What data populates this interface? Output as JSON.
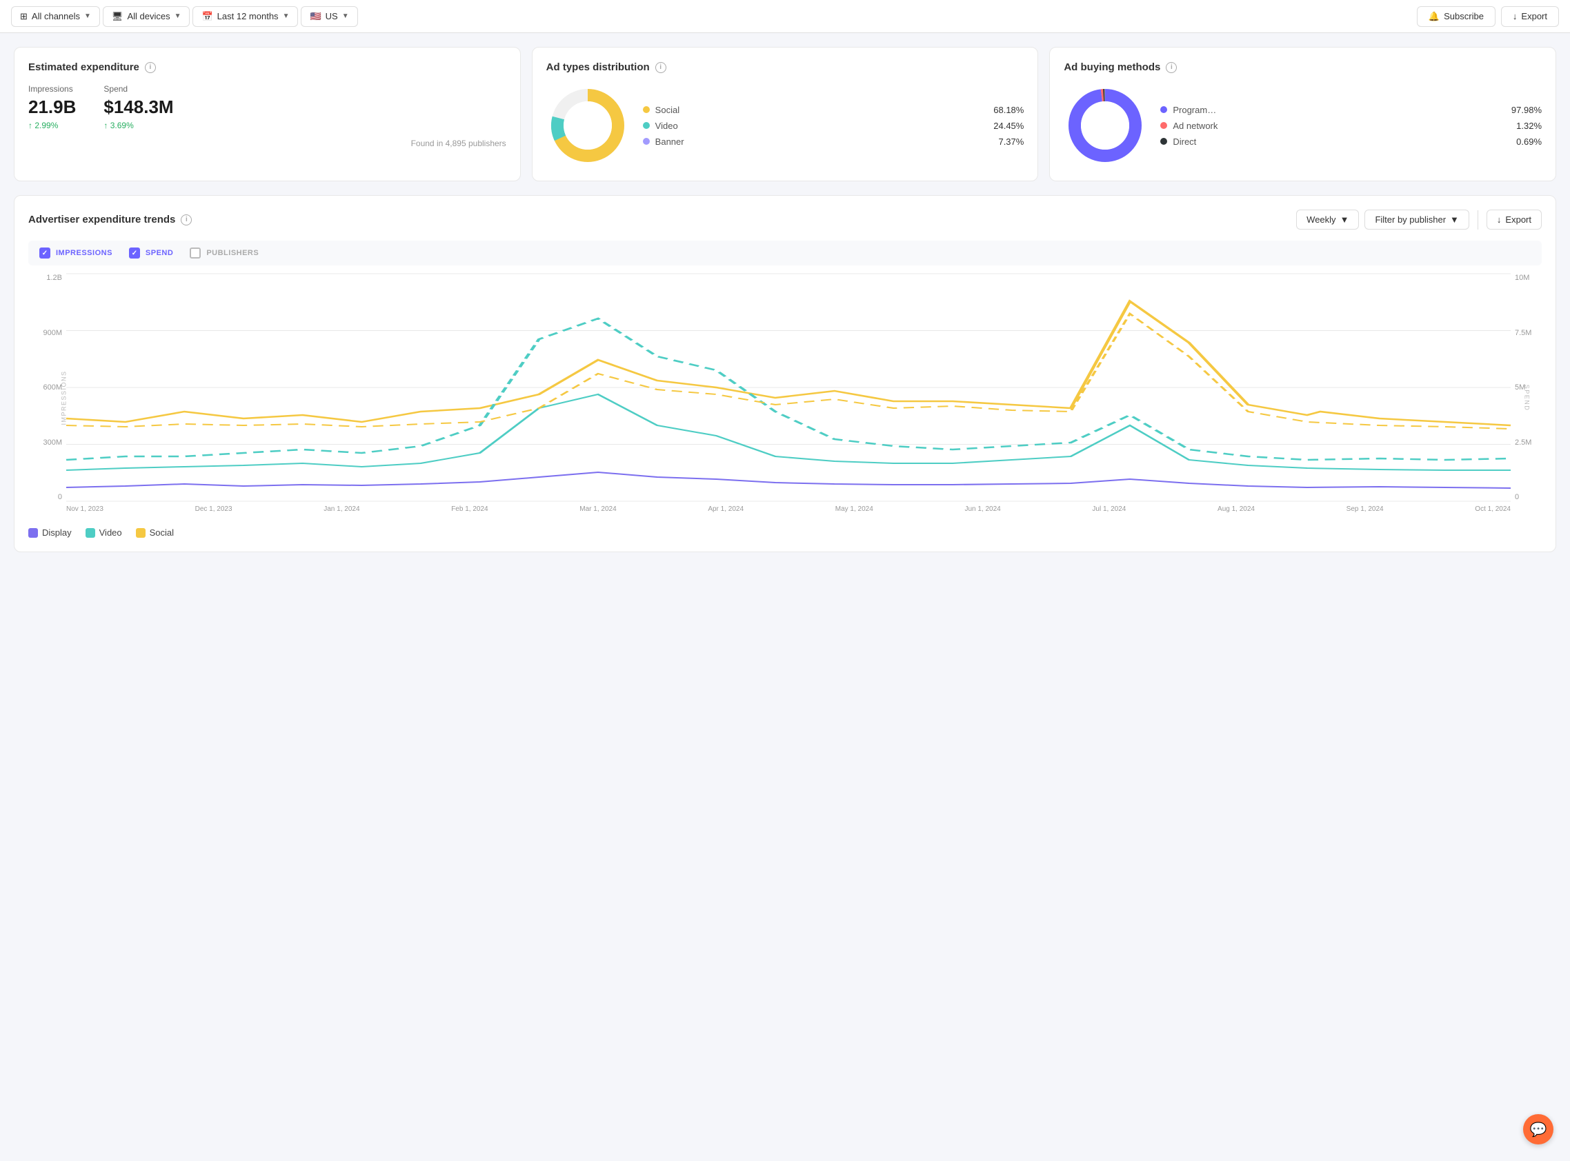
{
  "nav": {
    "channels_label": "All channels",
    "devices_label": "All devices",
    "date_label": "Last 12 months",
    "region_label": "US",
    "subscribe_label": "Subscribe",
    "export_label": "Export"
  },
  "expenditure": {
    "title": "Estimated expenditure",
    "impressions_label": "Impressions",
    "impressions_value": "21.9B",
    "impressions_delta": "↑ 2.99%",
    "spend_label": "Spend",
    "spend_value": "$148.3M",
    "spend_delta": "↑ 3.69%",
    "found_text": "Found in 4,895 publishers"
  },
  "ad_types": {
    "title": "Ad types distribution",
    "items": [
      {
        "label": "Social",
        "pct": "68.18%",
        "color": "#f5c842"
      },
      {
        "label": "Video",
        "pct": "24.45%",
        "color": "#4ecdc4"
      },
      {
        "label": "Banner",
        "pct": "7.37%",
        "color": "#a29bfe"
      }
    ]
  },
  "buying_methods": {
    "title": "Ad buying methods",
    "items": [
      {
        "label": "Program…",
        "pct": "97.98%",
        "color": "#6c63ff"
      },
      {
        "label": "Ad network",
        "pct": "1.32%",
        "color": "#ff6b6b"
      },
      {
        "label": "Direct",
        "pct": "0.69%",
        "color": "#2d3436"
      }
    ]
  },
  "trends": {
    "title": "Advertiser expenditure trends",
    "weekly_label": "Weekly",
    "filter_publisher_label": "Filter by publisher",
    "export_label": "Export",
    "checkboxes": [
      {
        "label": "IMPRESSIONS",
        "checked": true
      },
      {
        "label": "SPEND",
        "checked": true
      },
      {
        "label": "PUBLISHERS",
        "checked": false
      }
    ],
    "y_left": [
      "1.2B",
      "900M",
      "600M",
      "300M",
      "0"
    ],
    "y_right": [
      "10M",
      "7.5M",
      "5M",
      "2.5M",
      "0"
    ],
    "y_title_left": "IMPRESSIONS",
    "y_title_right": "SPEND",
    "x_labels": [
      "Nov 1, 2023",
      "Dec 1, 2023",
      "Jan 1, 2024",
      "Feb 1, 2024",
      "Mar 1, 2024",
      "Apr 1, 2024",
      "May 1, 2024",
      "Jun 1, 2024",
      "Jul 1, 2024",
      "Aug 1, 2024",
      "Sep 1, 2024",
      "Oct 1, 2024"
    ],
    "legend": [
      {
        "label": "Display",
        "color": "#7c6fef"
      },
      {
        "label": "Video",
        "color": "#4ecdc4"
      },
      {
        "label": "Social",
        "color": "#f5c842"
      }
    ]
  }
}
